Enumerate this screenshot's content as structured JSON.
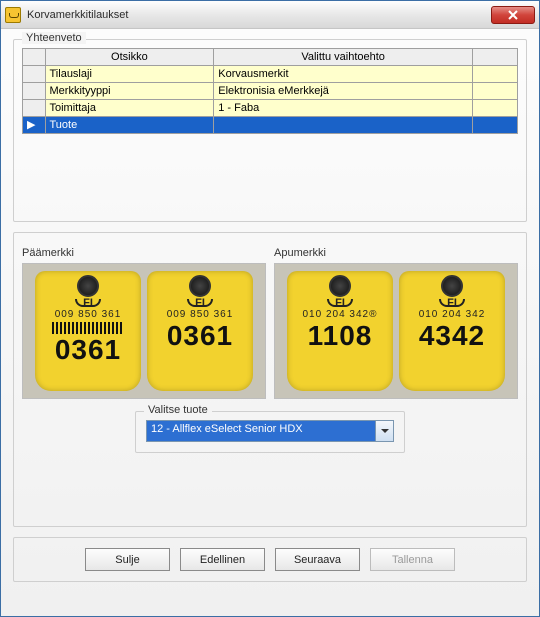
{
  "title": "Korvamerkkitilaukset",
  "summary": {
    "legend": "Yhteenveto",
    "headers": {
      "key": "Otsikko",
      "value": "Valittu vaihtoehto"
    },
    "rows": [
      {
        "key": "Tilauslaji",
        "value": "Korvausmerkit",
        "selected": false
      },
      {
        "key": "Merkkityyppi",
        "value": "Elektronisia eMerkkejä",
        "selected": false
      },
      {
        "key": "Toimittaja",
        "value": "1 - Faba",
        "selected": false
      },
      {
        "key": "Tuote",
        "value": "",
        "selected": true
      }
    ]
  },
  "tags": {
    "paamerkki": {
      "label": "Päämerkki",
      "left": {
        "fi": "FI",
        "small": "009 850 361",
        "big": "0361",
        "barcode": true
      },
      "right": {
        "fi": "FI",
        "small": "009 850 361",
        "big": "0361",
        "barcode": false
      }
    },
    "apumerkki": {
      "label": "Apumerkki",
      "left": {
        "fi": "FI",
        "small": "010  204  342®",
        "big": "1108",
        "barcode": false
      },
      "right": {
        "fi": "FI",
        "small": "010  204  342",
        "big": "4342",
        "barcode": false
      }
    }
  },
  "productSelect": {
    "legend": "Valitse tuote",
    "value": "12 - Allflex eSelect Senior HDX"
  },
  "buttons": {
    "close": "Sulje",
    "prev": "Edellinen",
    "next": "Seuraava",
    "save": "Tallenna"
  }
}
